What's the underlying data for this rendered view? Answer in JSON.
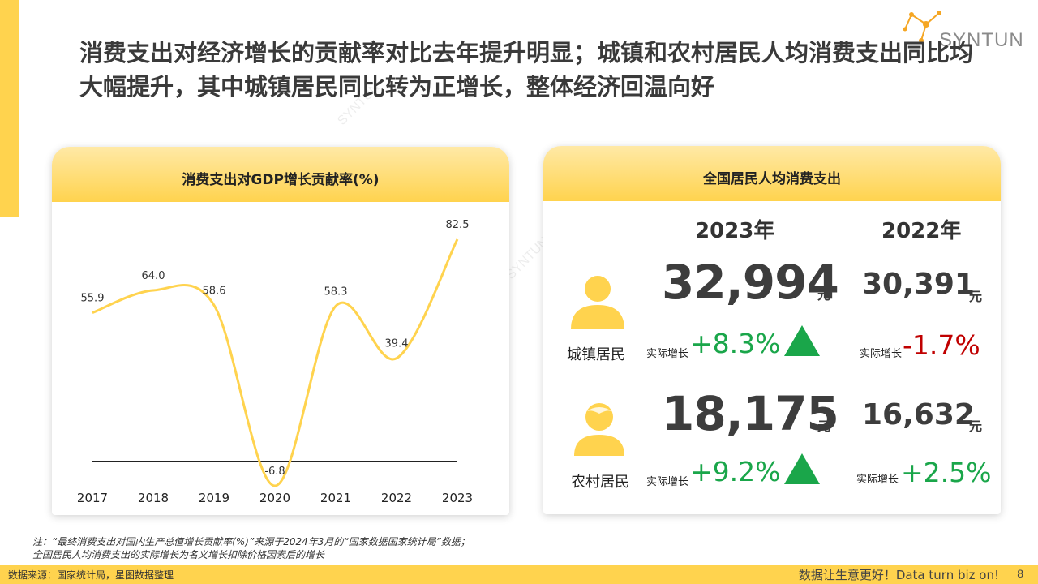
{
  "header": {
    "title": "消费支出对经济增长的贡献率对比去年提升明显；城镇和农村居民人均消费支出同比均大幅提升，其中城镇居民同比转为正增长，整体经济回温向好",
    "logo_text": "SYNTUN",
    "watermark": "SYNTUN"
  },
  "left_card": {
    "title": "消费支出对GDP增长贡献率(%)"
  },
  "chart_data": {
    "type": "line",
    "title": "消费支出对GDP增长贡献率(%)",
    "categories": [
      "2017",
      "2018",
      "2019",
      "2020",
      "2021",
      "2022",
      "2023"
    ],
    "series": [
      {
        "values": [
          55.9,
          64.0,
          58.6,
          -6.8,
          58.3,
          39.4,
          82.5
        ]
      }
    ],
    "value_labels": [
      "55.9",
      "64.0",
      "58.6",
      "-6.8",
      "58.3",
      "39.4",
      "82.5"
    ],
    "xlabel": "",
    "ylabel": "",
    "ylim": [
      -6.8,
      82.5
    ],
    "grid": false,
    "legend": "none",
    "line_color": "#FFD34E",
    "baseline_color": "#222222"
  },
  "right_card": {
    "title": "全国居民人均消费支出",
    "year_current": "2023年",
    "year_prev": "2022年",
    "unit": "元",
    "growth_label": "实际增长",
    "urban": {
      "name": "城镇居民",
      "value_2023": "32,994",
      "value_2022": "30,391",
      "growth_2023": "+8.3%",
      "growth_2022": "-1.7%"
    },
    "rural": {
      "name": "农村居民",
      "value_2023": "18,175",
      "value_2022": "16,632",
      "growth_2023": "+9.2%",
      "growth_2022": "+2.5%"
    },
    "colors": {
      "positive": "#1AA64A",
      "negative": "#C00000",
      "avatar": "#FFD34E"
    }
  },
  "notes": {
    "line1": "注：“最终消费支出对国内生产总值增长贡献率(%)”来源于2024年3月的“国家数据国家统计局”数据；",
    "line2": "全国居民人均消费支出的实际增长为名义增长扣除价格因素后的增长"
  },
  "footer": {
    "source": "数据来源：国家统计局，星图数据整理",
    "slogan": "数据让生意更好！Data turn biz on!",
    "page": "8"
  }
}
